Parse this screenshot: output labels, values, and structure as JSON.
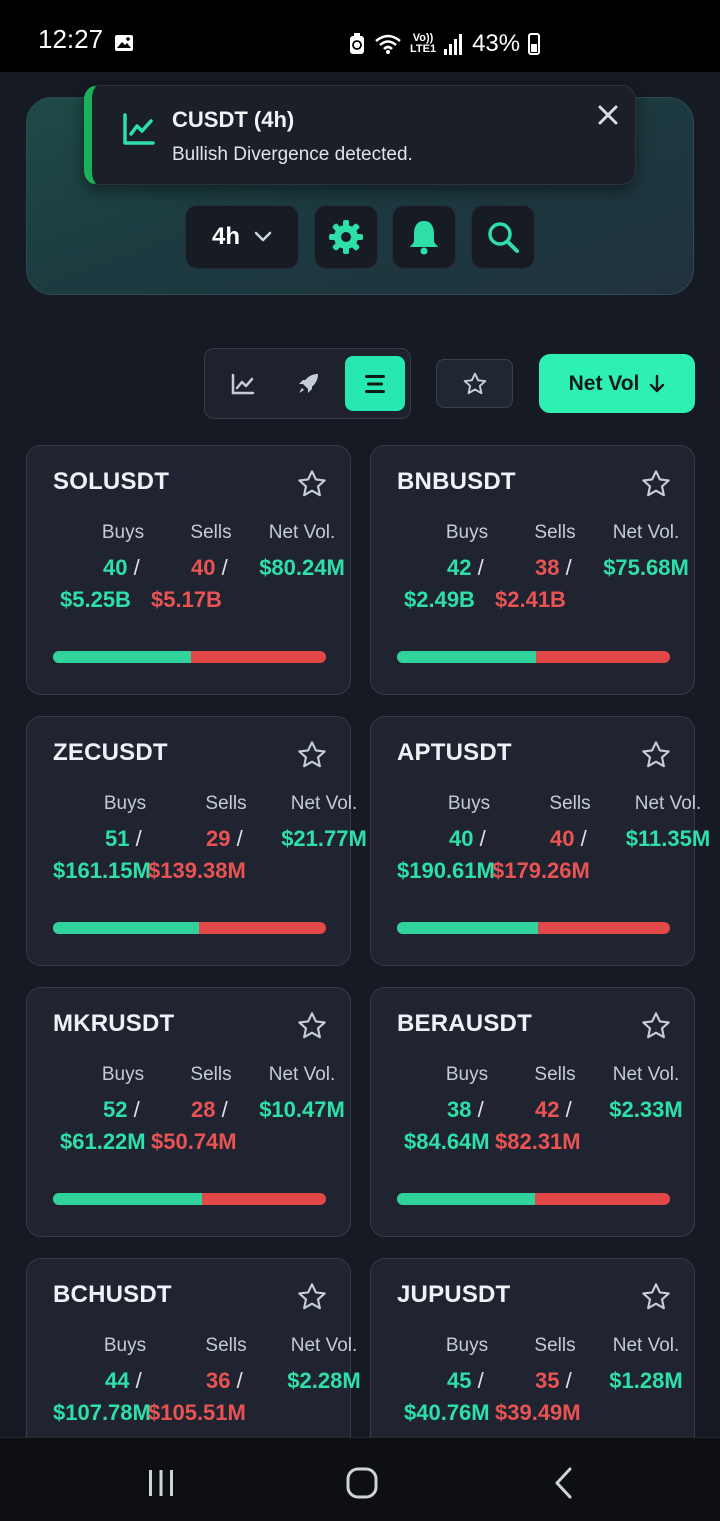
{
  "status_bar": {
    "time": "12:27",
    "volte": "Vo))\nLTE1",
    "battery": "43%"
  },
  "toast": {
    "title": "CUSDT (4h)",
    "message": "Bullish Divergence detected.",
    "accent": "#19b25a"
  },
  "controls": {
    "timeframe": "4h",
    "sort_label": "Net Vol",
    "accent": "#2ef0b2"
  },
  "labels": {
    "buys": "Buys",
    "sells": "Sells",
    "net_vol": "Net Vol."
  },
  "cards": [
    {
      "symbol": "SOLUSDT",
      "buys_count": "40",
      "buys_vol": "$5.25B",
      "sells_count": "40",
      "sells_vol": "$5.17B",
      "net_vol": "$80.24M",
      "buy_ratio": 0.504
    },
    {
      "symbol": "BNBUSDT",
      "buys_count": "42",
      "buys_vol": "$2.49B",
      "sells_count": "38",
      "sells_vol": "$2.41B",
      "net_vol": "$75.68M",
      "buy_ratio": 0.508
    },
    {
      "symbol": "ZECUSDT",
      "buys_count": "51",
      "buys_vol": "$161.15M",
      "sells_count": "29",
      "sells_vol": "$139.38M",
      "net_vol": "$21.77M",
      "buy_ratio": 0.536
    },
    {
      "symbol": "APTUSDT",
      "buys_count": "40",
      "buys_vol": "$190.61M",
      "sells_count": "40",
      "sells_vol": "$179.26M",
      "net_vol": "$11.35M",
      "buy_ratio": 0.515
    },
    {
      "symbol": "MKRUSDT",
      "buys_count": "52",
      "buys_vol": "$61.22M",
      "sells_count": "28",
      "sells_vol": "$50.74M",
      "net_vol": "$10.47M",
      "buy_ratio": 0.547
    },
    {
      "symbol": "BERAUSDT",
      "buys_count": "38",
      "buys_vol": "$84.64M",
      "sells_count": "42",
      "sells_vol": "$82.31M",
      "net_vol": "$2.33M",
      "buy_ratio": 0.507
    },
    {
      "symbol": "BCHUSDT",
      "buys_count": "44",
      "buys_vol": "$107.78M",
      "sells_count": "36",
      "sells_vol": "$105.51M",
      "net_vol": "$2.28M",
      "buy_ratio": 0.505
    },
    {
      "symbol": "JUPUSDT",
      "buys_count": "45",
      "buys_vol": "$40.76M",
      "sells_count": "35",
      "sells_vol": "$39.49M",
      "net_vol": "$1.28M",
      "buy_ratio": 0.508
    }
  ],
  "colors": {
    "buy": "#30d39c",
    "sell": "#e24848",
    "background": "#161a23",
    "card": "#1f2430"
  }
}
